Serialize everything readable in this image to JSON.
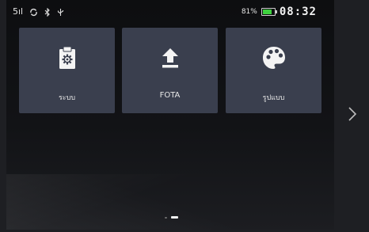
{
  "statusbar": {
    "signal": "5ıl",
    "icons": [
      "signal-icon",
      "sync-icon",
      "bluetooth-icon",
      "usb-icon"
    ],
    "battery_percent": "81%",
    "battery_level": 0.81,
    "time": "08:32"
  },
  "tiles": [
    {
      "label": "ระบบ",
      "icon": "clipboard-gear-icon"
    },
    {
      "label": "FOTA",
      "icon": "upload-arrow-icon"
    },
    {
      "label": "รูปแบบ",
      "icon": "palette-icon"
    }
  ],
  "pager": {
    "pages": 2,
    "active": 1
  },
  "nav": {
    "next": "chevron-right-icon"
  },
  "colors": {
    "tile_bg": "#3a3f4e",
    "battery_fill": "#3ed13e"
  }
}
